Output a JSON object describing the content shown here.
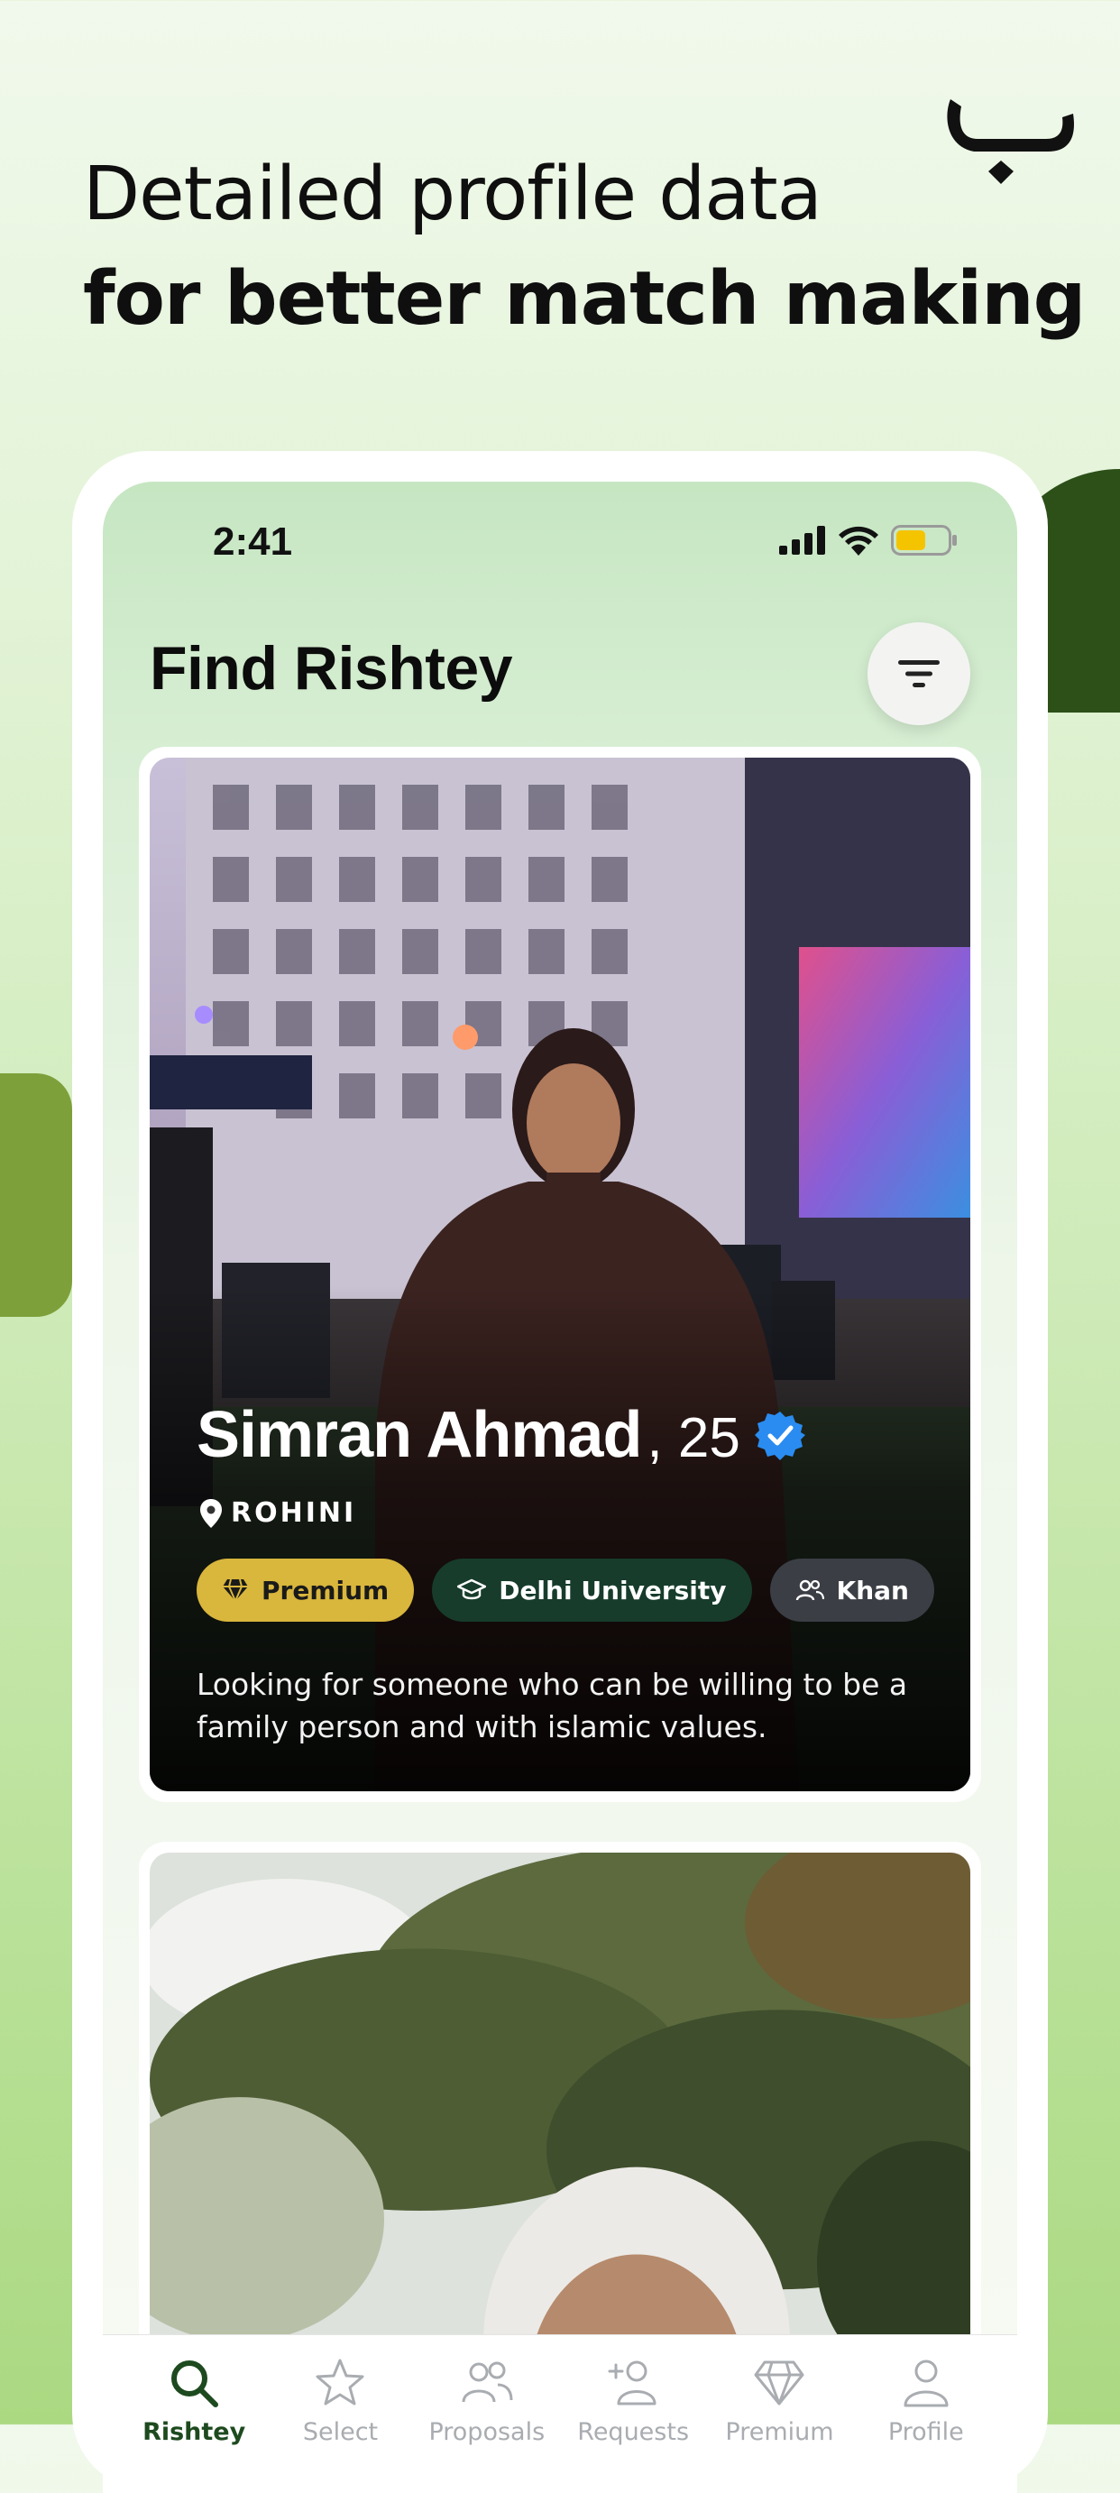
{
  "promo": {
    "headline_line1": "Detailed profile data",
    "headline_line2": "for better match making"
  },
  "status_bar": {
    "time": "2:41"
  },
  "screen": {
    "title": "Find Rishtey"
  },
  "profiles": [
    {
      "name": "Simran Ahmad",
      "age": ", 25",
      "verified": true,
      "location": "ROHINI",
      "tags": [
        {
          "label": "Premium",
          "icon": "diamond-icon",
          "color": "#d9b63c"
        },
        {
          "label": "Delhi University",
          "icon": "graduation-cap-icon",
          "color": "#173c2c"
        },
        {
          "label": "Khan",
          "icon": "people-icon",
          "color": "#3b3e44"
        }
      ],
      "bio": "Looking for someone who can be willing to be a family person and with islamic values."
    }
  ],
  "tab_bar": {
    "active": "Rishtey",
    "items": [
      {
        "label": "Rishtey",
        "icon": "search-icon"
      },
      {
        "label": "Select",
        "icon": "star-icon"
      },
      {
        "label": "Proposals",
        "icon": "people-icon"
      },
      {
        "label": "Requests",
        "icon": "add-person-icon"
      },
      {
        "label": "Premium",
        "icon": "diamond-icon"
      },
      {
        "label": "Profile",
        "icon": "person-icon"
      }
    ]
  },
  "colors": {
    "brand_dark_green": "#1d4a1e",
    "premium_gold": "#d9b63c",
    "verified_blue": "#2a8cf0",
    "battery_yellow": "#f5c400"
  }
}
